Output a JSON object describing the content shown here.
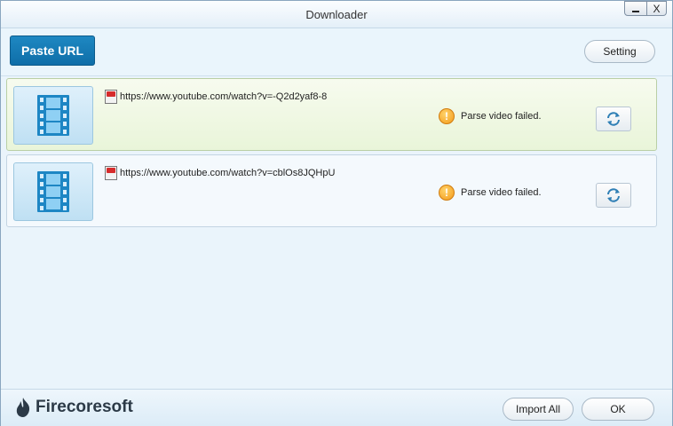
{
  "window": {
    "title": "Downloader",
    "minimize_icon": "minimize-icon",
    "close_label": "X"
  },
  "toolbar": {
    "paste_url_label": "Paste URL",
    "setting_label": "Setting"
  },
  "downloads": [
    {
      "url": "https://www.youtube.com/watch?v=-Q2d2yaf8-8",
      "status": "Parse video failed.",
      "source_icon": "youtube-icon",
      "status_icon": "warning-icon",
      "retry_icon": "refresh-icon",
      "selected": true
    },
    {
      "url": "https://www.youtube.com/watch?v=cblOs8JQHpU",
      "status": "Parse video failed.",
      "source_icon": "youtube-icon",
      "status_icon": "warning-icon",
      "retry_icon": "refresh-icon",
      "selected": false
    }
  ],
  "footer": {
    "brand": "Firecoresoft",
    "import_all_label": "Import All",
    "ok_label": "OK"
  },
  "colors": {
    "accent": "#1480bb",
    "selected_row": "#eaf5dc",
    "warning": "#f39a1a"
  }
}
